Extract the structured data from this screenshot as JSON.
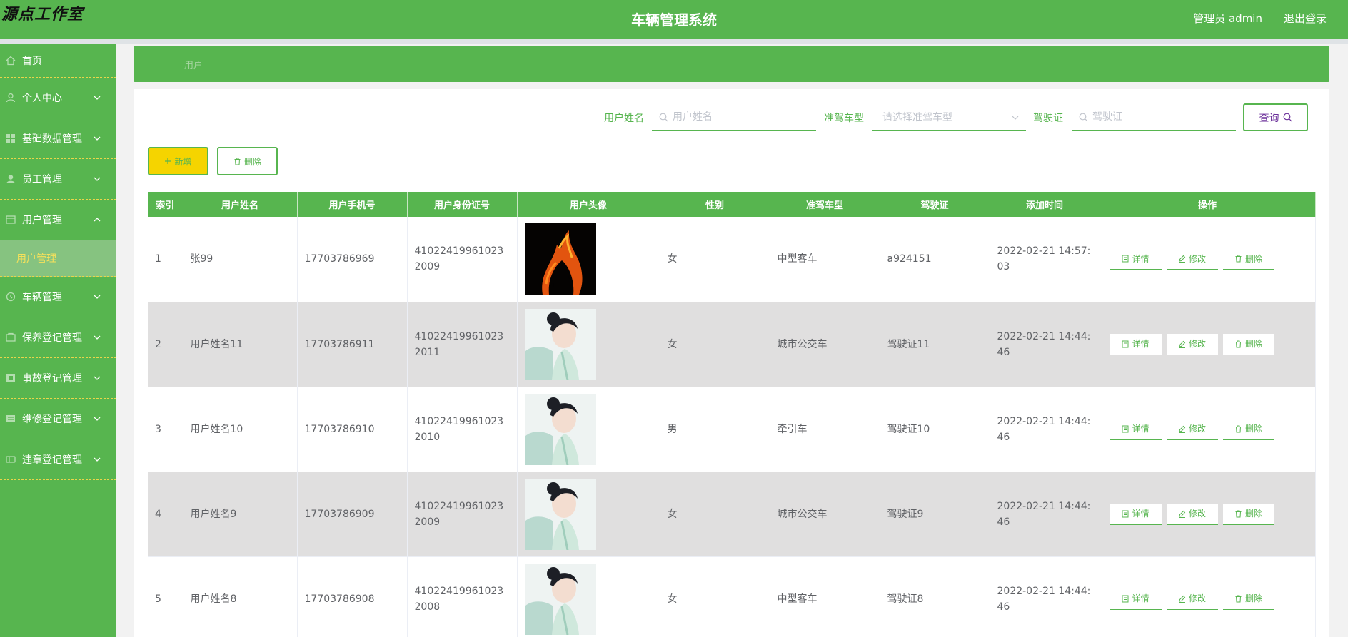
{
  "header": {
    "logo": "源点工作室",
    "title": "车辆管理系统",
    "admin": "管理员 admin",
    "logout": "退出登录"
  },
  "sidebar": {
    "items": [
      {
        "label": "首页",
        "icon": "home-icon"
      },
      {
        "label": "个人中心",
        "icon": "user-icon"
      },
      {
        "label": "基础数据管理",
        "icon": "grid-icon"
      },
      {
        "label": "员工管理",
        "icon": "person-icon"
      },
      {
        "label": "用户管理",
        "icon": "users-icon"
      },
      {
        "label": "车辆管理",
        "icon": "car-icon"
      },
      {
        "label": "保养登记管理",
        "icon": "wrench-icon"
      },
      {
        "label": "事故登记管理",
        "icon": "warning-icon"
      },
      {
        "label": "维修登记管理",
        "icon": "tool-icon"
      },
      {
        "label": "违章登记管理",
        "icon": "ticket-icon"
      }
    ],
    "submenu": "用户管理"
  },
  "breadcrumb": "用户",
  "search": {
    "name_label": "用户姓名",
    "name_placeholder": "用户姓名",
    "type_label": "准驾车型",
    "type_placeholder": "请选择准驾车型",
    "license_label": "驾驶证",
    "license_placeholder": "驾驶证",
    "query": "查询"
  },
  "actions": {
    "add": "新增",
    "delete": "删除"
  },
  "table": {
    "headers": [
      "索引",
      "用户姓名",
      "用户手机号",
      "用户身份证号",
      "用户头像",
      "性别",
      "准驾车型",
      "驾驶证",
      "添加时间",
      "操作"
    ],
    "rows": [
      {
        "idx": "1",
        "name": "张99",
        "phone": "17703786969",
        "idcard": "410224199610232009",
        "gender": "女",
        "type": "中型客车",
        "license": "a924151",
        "time": "2022-02-21 14:57:03"
      },
      {
        "idx": "2",
        "name": "用户姓名11",
        "phone": "17703786911",
        "idcard": "410224199610232011",
        "gender": "女",
        "type": "城市公交车",
        "license": "驾驶证11",
        "time": "2022-02-21 14:44:46"
      },
      {
        "idx": "3",
        "name": "用户姓名10",
        "phone": "17703786910",
        "idcard": "410224199610232010",
        "gender": "男",
        "type": "牵引车",
        "license": "驾驶证10",
        "time": "2022-02-21 14:44:46"
      },
      {
        "idx": "4",
        "name": "用户姓名9",
        "phone": "17703786909",
        "idcard": "410224199610232009",
        "gender": "女",
        "type": "城市公交车",
        "license": "驾驶证9",
        "time": "2022-02-21 14:44:46"
      },
      {
        "idx": "5",
        "name": "用户姓名8",
        "phone": "17703786908",
        "idcard": "410224199610232008",
        "gender": "女",
        "type": "中型客车",
        "license": "驾驶证8",
        "time": "2022-02-21 14:44:46"
      }
    ],
    "ops": {
      "detail": "详情",
      "edit": "修改",
      "delete": "删除"
    }
  }
}
